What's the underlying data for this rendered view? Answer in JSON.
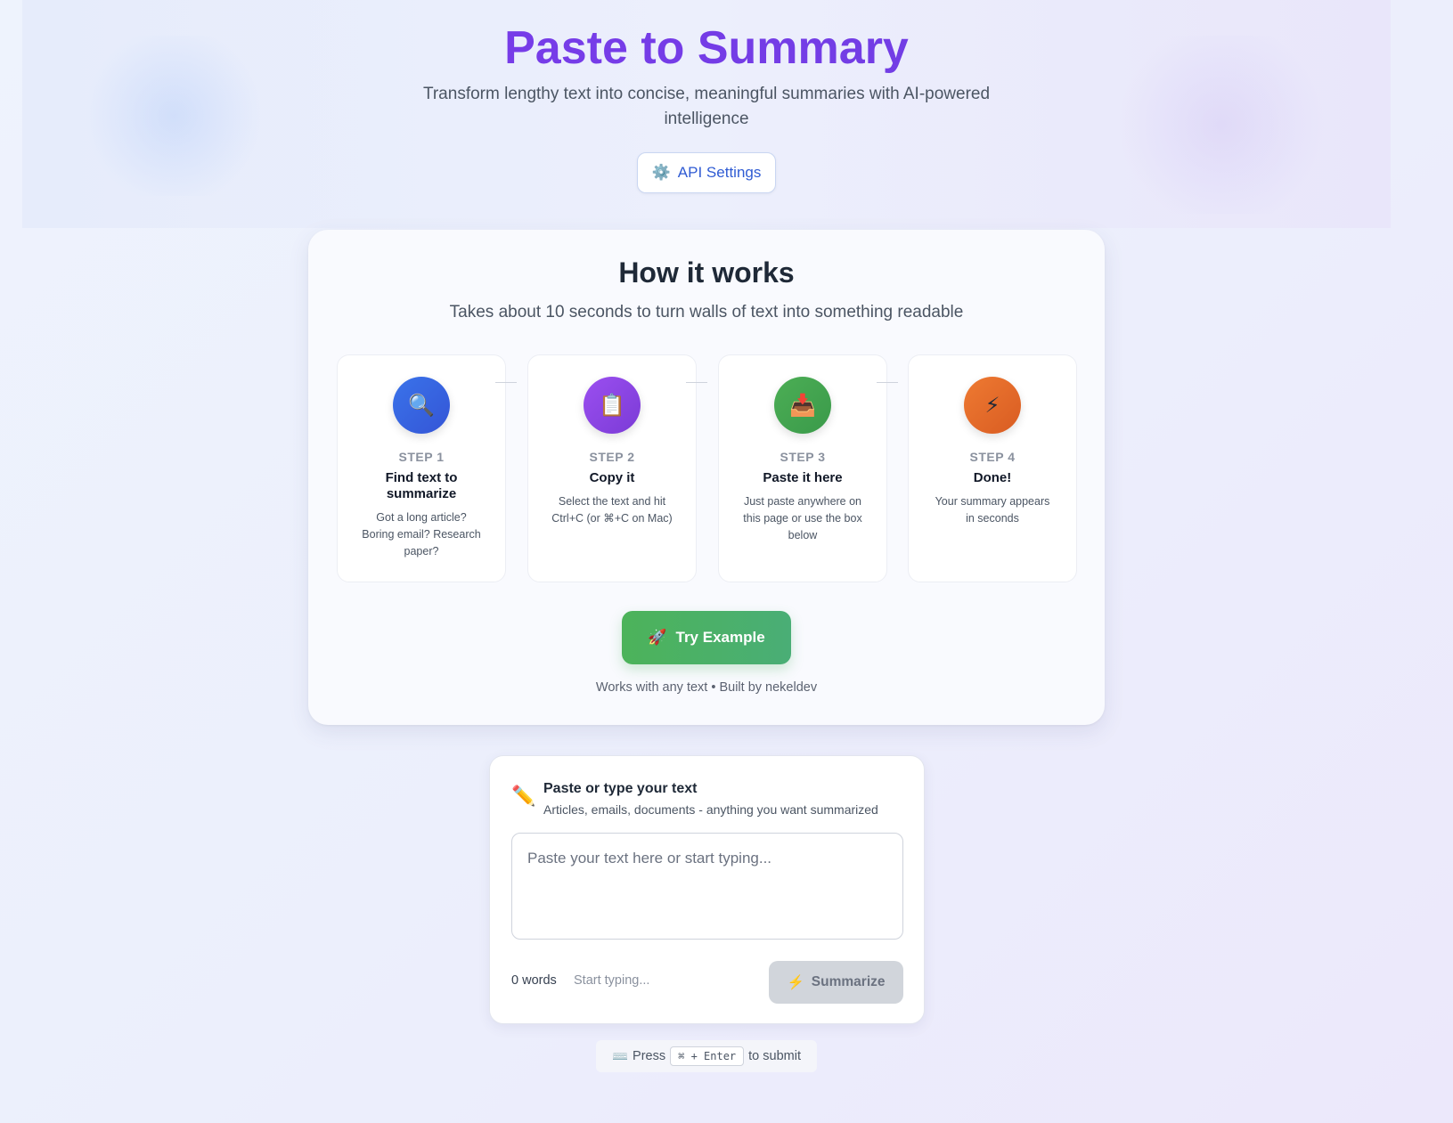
{
  "header": {
    "title": "Paste to Summary",
    "subtitle": "Transform lengthy text into concise, meaningful summaries with AI-powered intelligence",
    "api_settings": {
      "icon": "⚙️",
      "label": "API Settings"
    }
  },
  "how": {
    "title": "How it works",
    "subtitle": "Takes about 10 seconds to turn walls of text into something readable",
    "steps": [
      {
        "number": "STEP 1",
        "title": "Find text to summarize",
        "description": "Got a long article? Boring email? Research paper?",
        "icon": "🔍",
        "icon_name": "magnifier-icon",
        "color_from": "#3a73ea",
        "color_to": "#3455d6"
      },
      {
        "number": "STEP 2",
        "title": "Copy it",
        "description": "Select the text and hit Ctrl+C (or ⌘+C on Mac)",
        "icon": "📋",
        "icon_name": "clipboard-icon",
        "color_from": "#9b4ff0",
        "color_to": "#7b3bd6"
      },
      {
        "number": "STEP 3",
        "title": "Paste it here",
        "description": "Just paste anywhere on this page or use the box below",
        "icon": "📥",
        "icon_name": "inbox-tray-icon",
        "color_from": "#4cae55",
        "color_to": "#3a9a4a"
      },
      {
        "number": "STEP 4",
        "title": "Done!",
        "description": "Your summary appears in seconds",
        "icon": "⚡",
        "icon_name": "lightning-icon",
        "color_from": "#ee7a32",
        "color_to": "#d95c22"
      }
    ],
    "try_button": {
      "icon": "🚀",
      "label": "Try Example"
    },
    "footer": "Works with any text • Built by nekeldev"
  },
  "input": {
    "icon": "✏️",
    "title": "Paste or type your text",
    "subtitle": "Articles, emails, documents - anything you want summarized",
    "placeholder": "Paste your text here or start typing...",
    "value": "",
    "word_count": "0 words",
    "status": "Start typing...",
    "summarize": {
      "icon": "⚡",
      "label": "Summarize"
    }
  },
  "shortcut": {
    "icon": "⌨️",
    "prefix": "Press",
    "keys": "⌘ + Enter",
    "suffix": "to submit"
  }
}
